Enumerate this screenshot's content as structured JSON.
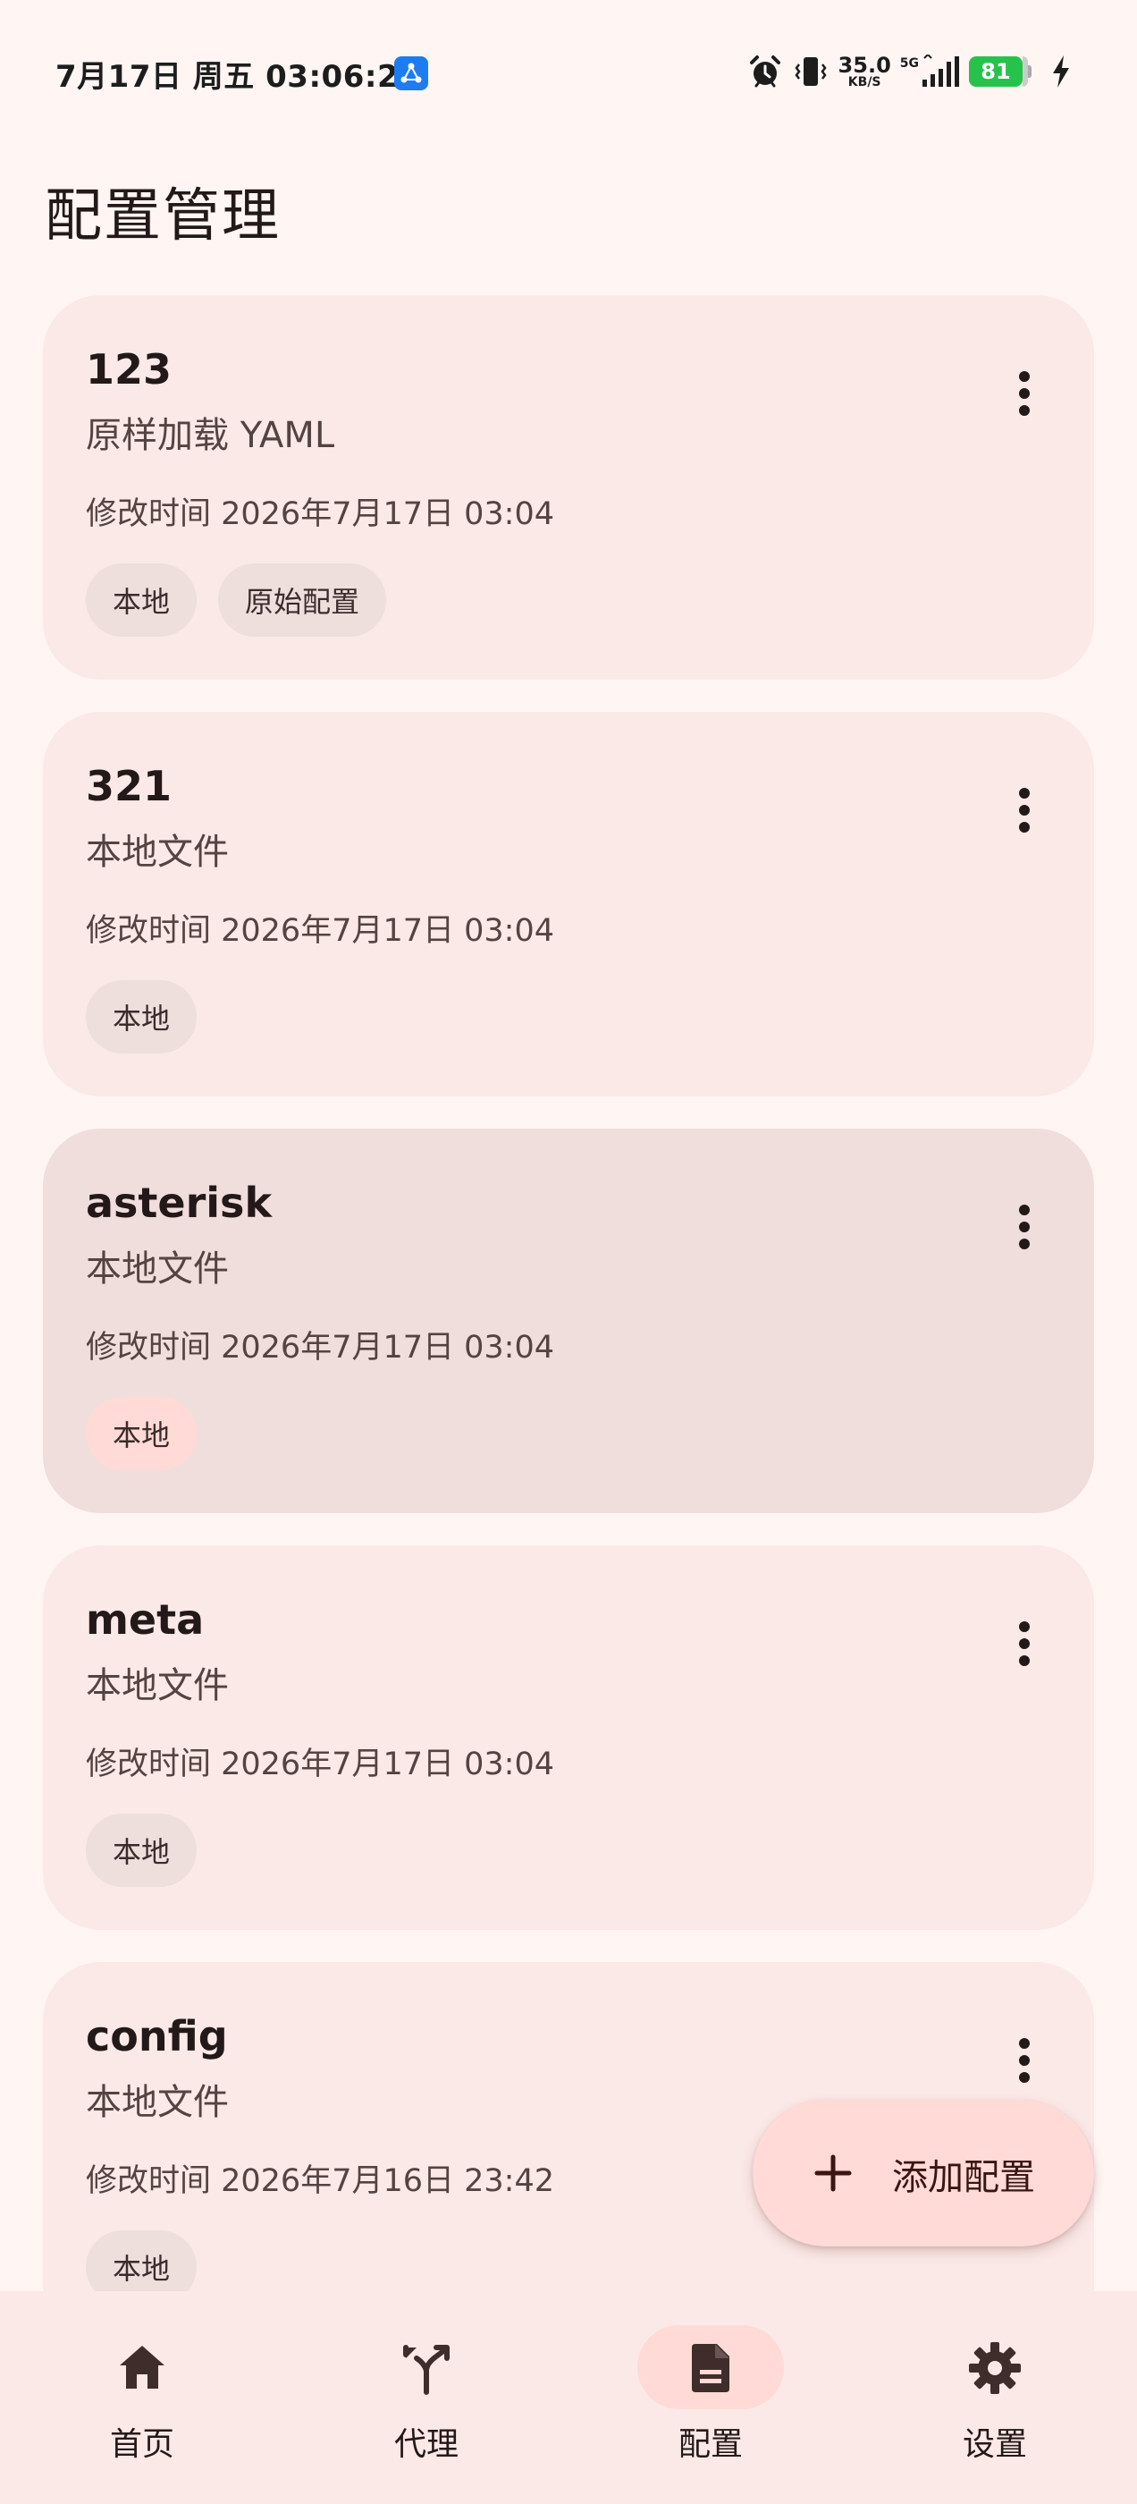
{
  "status_bar": {
    "time": "7月17日 周五 03:06:21",
    "net_speed_value": "35.0",
    "net_speed_unit": "KB/S",
    "network_type": "5G",
    "battery_level": "81"
  },
  "page": {
    "title": "配置管理"
  },
  "profiles": [
    {
      "name": "123",
      "type": "原样加载 YAML",
      "modified": "修改时间 2026年7月17日 03:04",
      "tags": [
        "本地",
        "原始配置"
      ]
    },
    {
      "name": "321",
      "type": "本地文件",
      "modified": "修改时间 2026年7月17日 03:04",
      "tags": [
        "本地"
      ]
    },
    {
      "name": "asterisk",
      "type": "本地文件",
      "modified": "修改时间 2026年7月17日 03:04",
      "tags": [
        "本地"
      ],
      "selected": true
    },
    {
      "name": "meta",
      "type": "本地文件",
      "modified": "修改时间 2026年7月17日 03:04",
      "tags": [
        "本地"
      ]
    },
    {
      "name": "config",
      "type": "本地文件",
      "modified": "修改时间 2026年7月16日 23:42",
      "tags": [
        "本地"
      ]
    }
  ],
  "fab": {
    "label": "添加配置",
    "icon": "plus-icon"
  },
  "bottom_nav": [
    {
      "label": "首页",
      "icon": "home-icon"
    },
    {
      "label": "代理",
      "icon": "proxy-fork-icon"
    },
    {
      "label": "配置",
      "icon": "document-icon",
      "active": true
    },
    {
      "label": "设置",
      "icon": "gear-icon"
    }
  ],
  "colors": {
    "background": "#FFF6F4",
    "card": "#FBE9E7",
    "card_selected": "#F0DEDC",
    "tag": "#EEDEDC",
    "accent_container": "#FFDAD6",
    "text_primary": "#231918",
    "text_secondary": "#534341",
    "battery": "#27C24C",
    "app_badge": "#1D7DF0"
  }
}
